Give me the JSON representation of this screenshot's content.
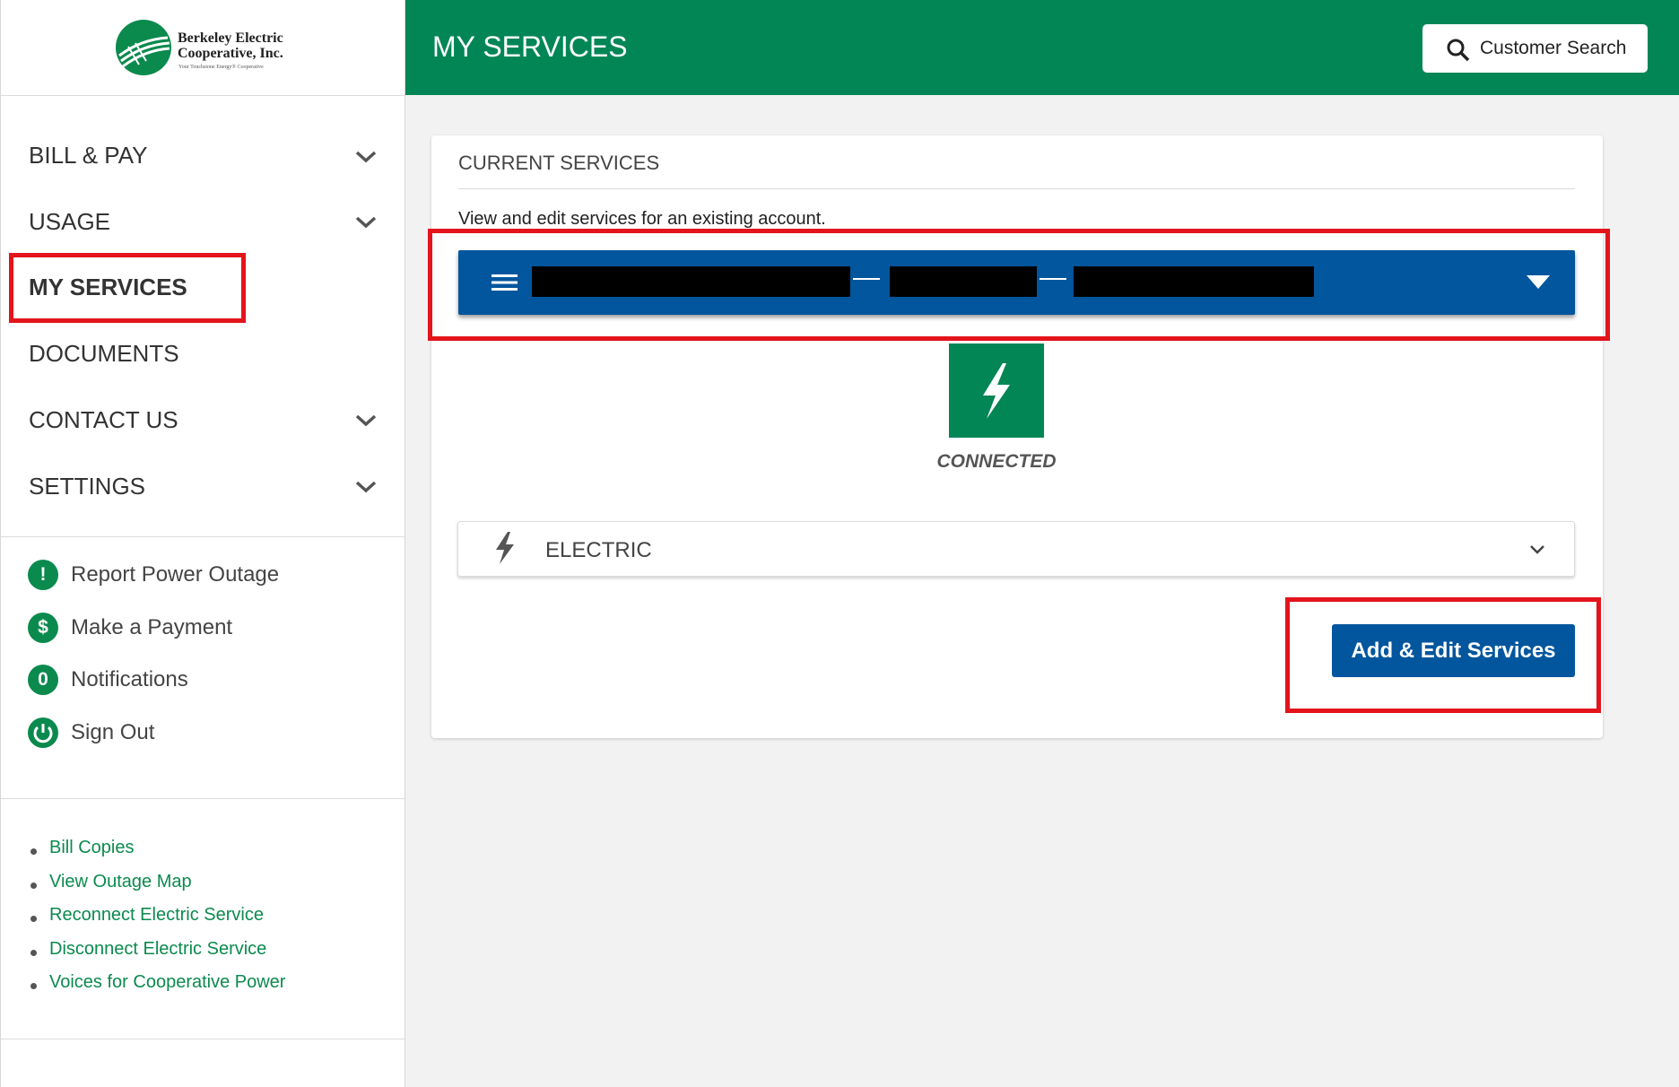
{
  "logo": {
    "line1": "Berkeley Electric",
    "line2": "Cooperative, Inc.",
    "tagline": "Your Touchstone Energy® Cooperative"
  },
  "nav": {
    "items": [
      {
        "label": "BILL & PAY",
        "has_dropdown": true
      },
      {
        "label": "USAGE",
        "has_dropdown": true
      },
      {
        "label": "MY SERVICES",
        "has_dropdown": false
      },
      {
        "label": "DOCUMENTS",
        "has_dropdown": false
      },
      {
        "label": "CONTACT US",
        "has_dropdown": true
      },
      {
        "label": "SETTINGS",
        "has_dropdown": true
      }
    ]
  },
  "quick_actions": [
    {
      "icon": "!",
      "label": "Report Power Outage"
    },
    {
      "icon": "$",
      "label": "Make a Payment"
    },
    {
      "icon": "0",
      "label": "Notifications"
    },
    {
      "icon": "power-icon",
      "label": "Sign Out"
    }
  ],
  "links": [
    "Bill Copies",
    "View Outage Map",
    "Reconnect Electric Service",
    "Disconnect Electric Service",
    "Voices for Cooperative Power"
  ],
  "header": {
    "title": "MY SERVICES",
    "search_label": "Customer Search"
  },
  "card": {
    "title": "CURRENT SERVICES",
    "description": "View and edit services for an existing account.",
    "status": "CONNECTED",
    "service_name": "ELECTRIC",
    "edit_button": "Add & Edit Services"
  },
  "colors": {
    "brand_green": "#028656",
    "brand_blue": "#01569d",
    "highlight_red": "#e3141c"
  }
}
